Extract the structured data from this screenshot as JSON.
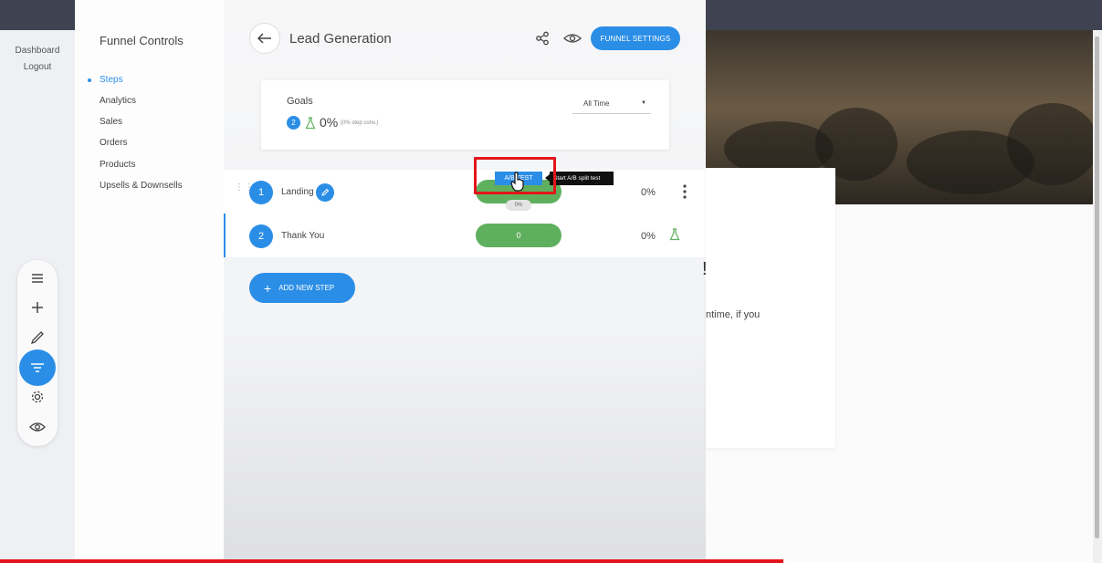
{
  "app_nav": {
    "dashboard": "Dashboard",
    "logout": "Logout"
  },
  "tools": [
    "menu-icon",
    "plus-icon",
    "brush-icon",
    "funnel-icon",
    "gear-icon",
    "eye-icon"
  ],
  "sidebar": {
    "title": "Funnel Controls",
    "items": [
      {
        "label": "Steps",
        "active": true
      },
      {
        "label": "Analytics"
      },
      {
        "label": "Sales"
      },
      {
        "label": "Orders"
      },
      {
        "label": "Products"
      },
      {
        "label": "Upsells & Downsells"
      }
    ]
  },
  "header": {
    "title": "Lead Generation",
    "settings_label": "FUNNEL SETTINGS"
  },
  "goals": {
    "label": "Goals",
    "count": "2",
    "percent": "0%",
    "conv": "(0% step conv.)",
    "range": "All Time"
  },
  "steps": [
    {
      "num": "1",
      "name": "Landing",
      "pill": "",
      "badge": "0%",
      "pct": "0%"
    },
    {
      "num": "2",
      "name": "Thank You",
      "pill": "0",
      "pct": "0%"
    }
  ],
  "ab_test": {
    "label": "A/B TEST",
    "tooltip": "Start A/B split test"
  },
  "add_step": "ADD NEW STEP",
  "preview": {
    "text": "ntime, if you",
    "mark": "!"
  },
  "colors": {
    "accent": "#2b8ee6",
    "green": "#5fb05e",
    "highlight": "#e3151a"
  }
}
